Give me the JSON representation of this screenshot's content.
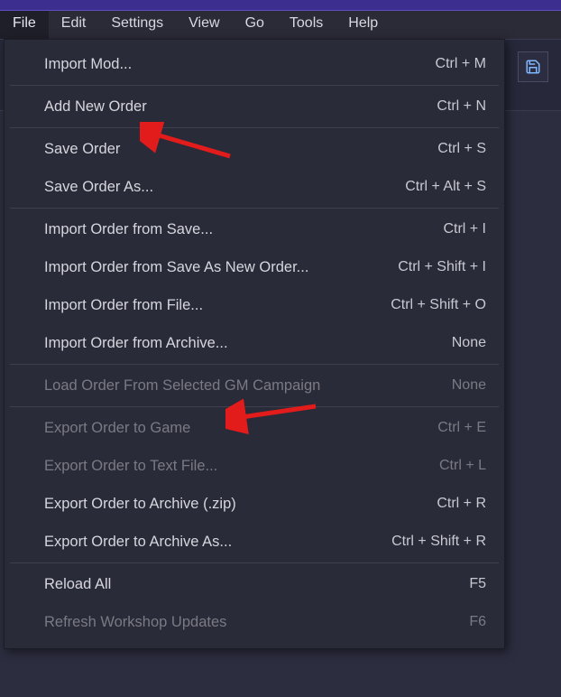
{
  "menubar": {
    "items": [
      {
        "label": "File"
      },
      {
        "label": "Edit"
      },
      {
        "label": "Settings"
      },
      {
        "label": "View"
      },
      {
        "label": "Go"
      },
      {
        "label": "Tools"
      },
      {
        "label": "Help"
      }
    ],
    "active_index": 0
  },
  "dropdown": {
    "groups": [
      [
        {
          "label": "Import Mod...",
          "shortcut": "Ctrl + M",
          "disabled": false
        }
      ],
      [
        {
          "label": "Add New Order",
          "shortcut": "Ctrl + N",
          "disabled": false
        }
      ],
      [
        {
          "label": "Save Order",
          "shortcut": "Ctrl + S",
          "disabled": false
        },
        {
          "label": "Save Order As...",
          "shortcut": "Ctrl + Alt + S",
          "disabled": false
        }
      ],
      [
        {
          "label": "Import Order from Save...",
          "shortcut": "Ctrl + I",
          "disabled": false
        },
        {
          "label": "Import Order from Save As New Order...",
          "shortcut": "Ctrl + Shift + I",
          "disabled": false
        },
        {
          "label": "Import Order from File...",
          "shortcut": "Ctrl + Shift + O",
          "disabled": false
        },
        {
          "label": "Import Order from Archive...",
          "shortcut": "None",
          "disabled": false
        }
      ],
      [
        {
          "label": "Load Order From Selected GM Campaign",
          "shortcut": "None",
          "disabled": true
        }
      ],
      [
        {
          "label": "Export Order to Game",
          "shortcut": "Ctrl + E",
          "disabled": true
        },
        {
          "label": "Export Order to Text File...",
          "shortcut": "Ctrl + L",
          "disabled": true
        },
        {
          "label": "Export Order to Archive (.zip)",
          "shortcut": "Ctrl + R",
          "disabled": false
        },
        {
          "label": "Export Order to Archive As...",
          "shortcut": "Ctrl + Shift + R",
          "disabled": false
        }
      ],
      [
        {
          "label": "Reload All",
          "shortcut": "F5",
          "disabled": false
        },
        {
          "label": "Refresh Workshop Updates",
          "shortcut": "F6",
          "disabled": true
        }
      ]
    ]
  },
  "annotations": {
    "arrow1_target": "Save Order",
    "arrow2_target": "Export Order to Game"
  }
}
